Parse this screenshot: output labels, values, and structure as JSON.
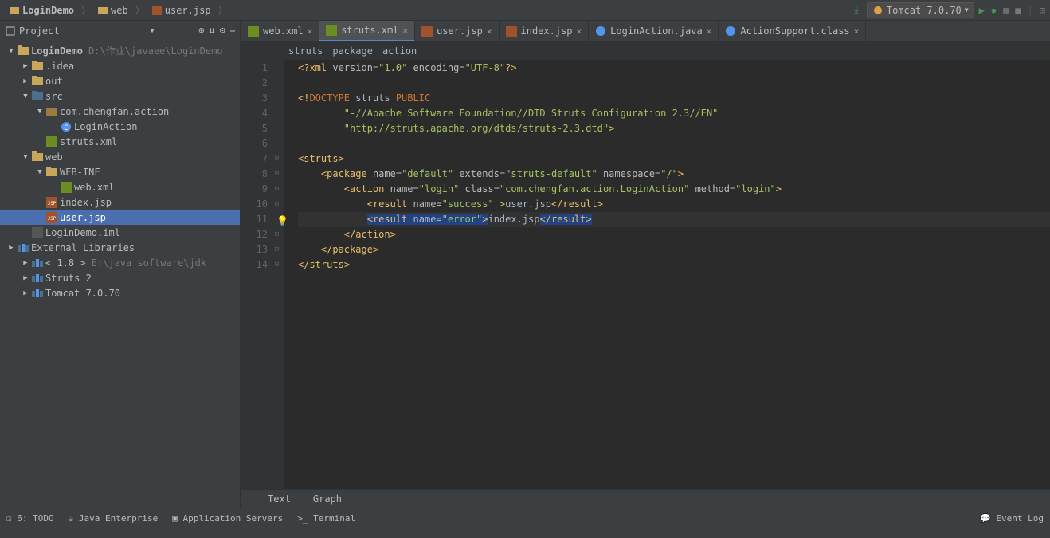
{
  "breadcrumb": {
    "project": "LoginDemo",
    "folder": "web",
    "file": "user.jsp"
  },
  "run": {
    "config": "Tomcat 7.0.70"
  },
  "sidebar": {
    "title": "Project",
    "tree": [
      {
        "indent": 0,
        "arrow": "▼",
        "type": "folder",
        "label": "LoginDemo",
        "path": "D:\\作业\\javaee\\LoginDemo",
        "bold": true
      },
      {
        "indent": 1,
        "arrow": "▶",
        "type": "folder",
        "label": ".idea"
      },
      {
        "indent": 1,
        "arrow": "▶",
        "type": "folder",
        "label": "out"
      },
      {
        "indent": 1,
        "arrow": "▼",
        "type": "srcfolder",
        "label": "src"
      },
      {
        "indent": 2,
        "arrow": "▼",
        "type": "package",
        "label": "com.chengfan.action"
      },
      {
        "indent": 3,
        "arrow": "",
        "type": "class",
        "label": "LoginAction"
      },
      {
        "indent": 2,
        "arrow": "",
        "type": "xml",
        "label": "struts.xml"
      },
      {
        "indent": 1,
        "arrow": "▼",
        "type": "webfolder",
        "label": "web"
      },
      {
        "indent": 2,
        "arrow": "▼",
        "type": "folder",
        "label": "WEB-INF"
      },
      {
        "indent": 3,
        "arrow": "",
        "type": "xml",
        "label": "web.xml"
      },
      {
        "indent": 2,
        "arrow": "",
        "type": "jsp",
        "label": "index.jsp"
      },
      {
        "indent": 2,
        "arrow": "",
        "type": "jsp",
        "label": "user.jsp",
        "selected": true
      },
      {
        "indent": 1,
        "arrow": "",
        "type": "iml",
        "label": "LoginDemo.iml"
      },
      {
        "indent": 0,
        "arrow": "▶",
        "type": "lib",
        "label": "External Libraries"
      },
      {
        "indent": 1,
        "arrow": "▶",
        "type": "lib",
        "label": "< 1.8 >",
        "path": "E:\\java software\\jdk"
      },
      {
        "indent": 1,
        "arrow": "▶",
        "type": "lib",
        "label": "Struts 2"
      },
      {
        "indent": 1,
        "arrow": "▶",
        "type": "lib",
        "label": "Tomcat 7.0.70"
      }
    ]
  },
  "tabs": [
    {
      "icon": "xml",
      "label": "web.xml",
      "active": false
    },
    {
      "icon": "xml",
      "label": "struts.xml",
      "active": true
    },
    {
      "icon": "jsp",
      "label": "user.jsp",
      "active": false
    },
    {
      "icon": "jsp",
      "label": "index.jsp",
      "active": false
    },
    {
      "icon": "class",
      "label": "LoginAction.java",
      "active": false
    },
    {
      "icon": "class",
      "label": "ActionSupport.class",
      "active": false
    }
  ],
  "crumbs": [
    "struts",
    "package",
    "action"
  ],
  "lines": [
    "1",
    "2",
    "3",
    "4",
    "5",
    "6",
    "7",
    "8",
    "9",
    "10",
    "11",
    "12",
    "13",
    "14"
  ],
  "code": {
    "l1": {
      "pre": "<?",
      "xml": "xml ",
      "ver_attr": "version",
      "eq": "=",
      "ver_val": "\"1.0\"",
      "sp": " ",
      "enc_attr": "encoding",
      "enc_val": "\"UTF-8\"",
      "post": "?>"
    },
    "l3a": "<!",
    "l3b": "DOCTYPE",
    "l3c": " struts ",
    "l3d": "PUBLIC",
    "l4": "\"-//Apache Software Foundation//DTD Struts Configuration 2.3//EN\"",
    "l5": "\"http://struts.apache.org/dtds/struts-2.3.dtd\"",
    "l5b": ">",
    "l7_open": "<",
    "l7_tag": "struts",
    "l7_close": ">",
    "l8_open": "<",
    "l8_tag": "package",
    "l8_a1": " name",
    "l8_v1": "\"default\"",
    "l8_a2": " extends",
    "l8_v2": "\"struts-default\"",
    "l8_a3": " namespace",
    "l8_v3": "\"/\"",
    "l8_close": ">",
    "l9_open": "<",
    "l9_tag": "action",
    "l9_a1": " name",
    "l9_v1": "\"login\"",
    "l9_a2": " class",
    "l9_v2": "\"com.chengfan.action.LoginAction\"",
    "l9_a3": " method",
    "l9_v3": "\"login\"",
    "l9_close": ">",
    "l10_open": "<",
    "l10_tag": "result",
    "l10_a1": " name",
    "l10_v1": "\"success\"",
    "l10_mid": " >",
    "l10_txt": "user.jsp",
    "l10_c1": "</",
    "l10_ctag": "result",
    "l10_c2": ">",
    "l11_open": "<",
    "l11_tag": "result",
    "l11_a1": " name",
    "l11_v1": "\"error\"",
    "l11_mid": ">",
    "l11_txt": "index.jsp",
    "l11_c1": "</",
    "l11_ctag": "result",
    "l11_c2": ">",
    "l12_open": "</",
    "l12_tag": "action",
    "l12_close": ">",
    "l13_open": "</",
    "l13_tag": "package",
    "l13_close": ">",
    "l14_open": "</",
    "l14_tag": "struts",
    "l14_close": ">"
  },
  "viewtabs": {
    "text": "Text",
    "graph": "Graph"
  },
  "status": {
    "todo": "6: TODO",
    "java": "Java Enterprise",
    "servers": "Application Servers",
    "terminal": "Terminal",
    "event": "Event Log"
  }
}
